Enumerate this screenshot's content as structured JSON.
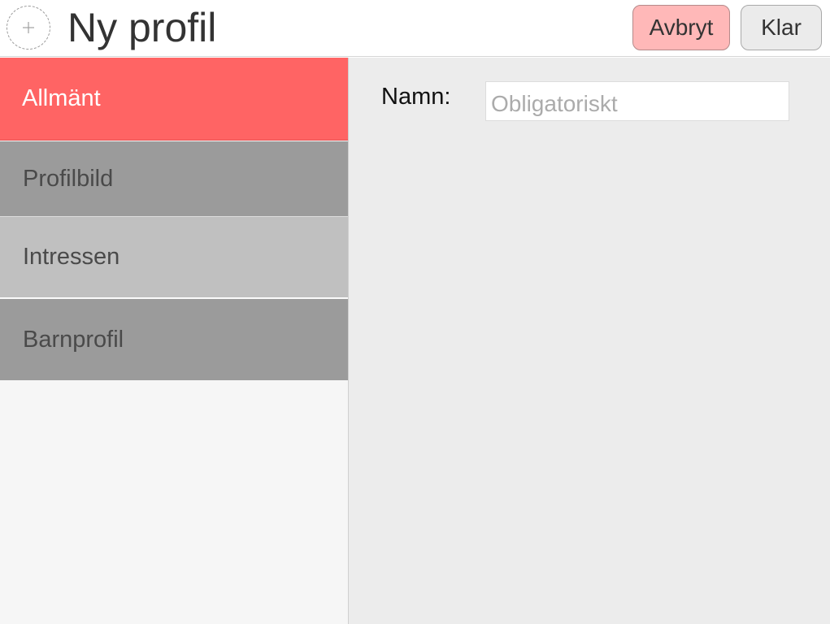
{
  "header": {
    "title": "Ny profil",
    "avatar_icon": "plus-icon",
    "cancel_label": "Avbryt",
    "done_label": "Klar"
  },
  "sidebar": {
    "items": [
      {
        "label": "Allmänt",
        "active": true
      },
      {
        "label": "Profilbild",
        "active": false
      },
      {
        "label": "Intressen",
        "active": false
      },
      {
        "label": "Barnprofil",
        "active": false
      }
    ]
  },
  "form": {
    "name_label": "Namn:",
    "name_value": "",
    "name_placeholder": "Obligatoriskt"
  },
  "colors": {
    "active_tab": "#ff6464",
    "cancel_button": "#ffb8b8",
    "tab_dark": "#9b9b9b",
    "tab_light": "#c0c0c0",
    "content_bg": "#ececec"
  }
}
